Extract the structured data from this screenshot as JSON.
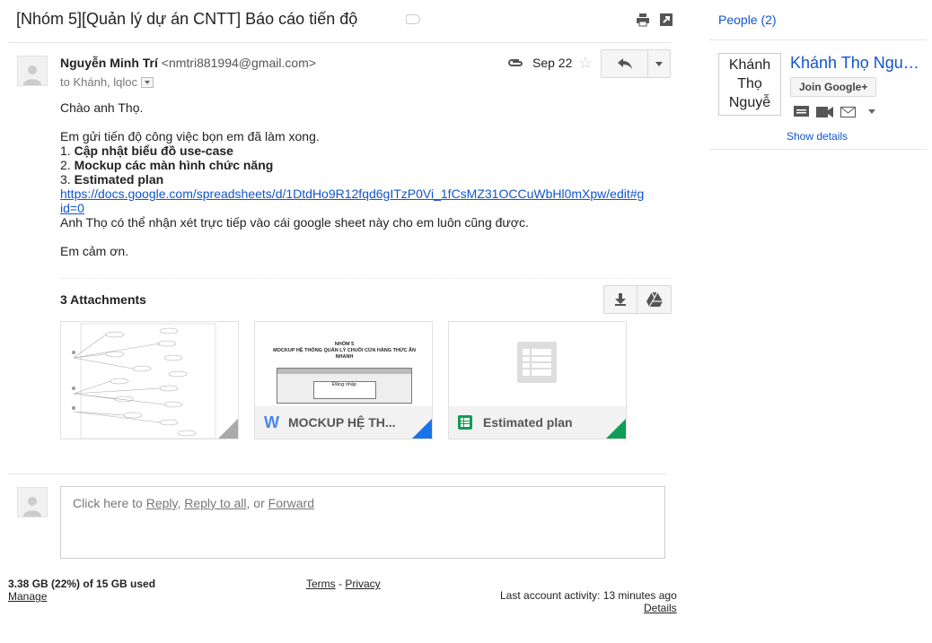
{
  "subject": "[Nhóm 5][Quản lý dự án CNTT] Báo cáo tiến độ",
  "message": {
    "sender_name": "Nguyễn Minh Trí",
    "sender_email": "<nmtri881994@gmail.com>",
    "to_line": "to Khánh, lqloc",
    "date": "Sep 22",
    "greeting": "Chào anh Thọ.",
    "intro": "Em gửi tiến độ công việc bọn em đã làm xong.",
    "items": [
      {
        "num": "1.",
        "text": "Cập nhật biểu đồ use-case"
      },
      {
        "num": "2.",
        "text": "Mockup các màn hình chức năng"
      },
      {
        "num": "3.",
        "text": "Estimated plan"
      }
    ],
    "link_line1": "https://docs.google.com/spreadsheets/d/1DtdHo9R12fqd6gITzP0Vi_1fCsMZ31OCCuWbHl0mXpw/edit#g",
    "link_line2": "id=0",
    "note": "Anh Thọ có thể nhận xét trực tiếp vào cái google sheet này cho em luôn cũng được.",
    "closing": "Em cảm ơn."
  },
  "attachments": {
    "title": "3 Attachments",
    "cards": [
      {
        "name": ""
      },
      {
        "name": "MOCKUP HỆ TH...",
        "preview_title": "NHÓM 5",
        "preview_sub": "MOCKUP HỆ THỐNG QUẢN LÝ CHUỖI CỬA HÀNG THỨC ĂN NHANH",
        "preview_label": "Đăng nhập",
        "color": "#1a73e8"
      },
      {
        "name": "Estimated plan",
        "color": "#0f9d58"
      }
    ]
  },
  "reply": {
    "prefix": "Click here to ",
    "reply": "Reply",
    "sep1": ", ",
    "reply_all": "Reply to all",
    "sep2": ", or ",
    "forward": "Forward"
  },
  "footer": {
    "storage": "3.38 GB (22%) of 15 GB used",
    "manage": "Manage",
    "terms": "Terms",
    "dash": " - ",
    "privacy": "Privacy",
    "activity": "Last account activity: 13 minutes ago",
    "details": "Details"
  },
  "sidebar": {
    "people": "People (2)",
    "person_name": "Khánh Thọ Ngu…",
    "photo_alt": "Khánh Thọ Nguyễ",
    "join": "Join Google+",
    "show_details": "Show details"
  }
}
